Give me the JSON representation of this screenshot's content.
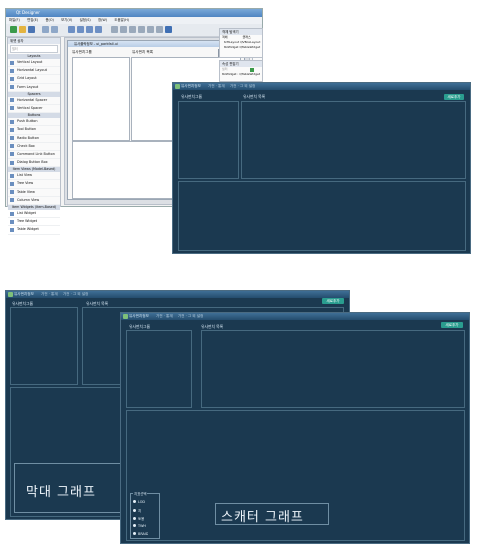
{
  "designer": {
    "title": "Qt Designer",
    "menu": [
      "파일(F)",
      "편집(E)",
      "폼(O)",
      "보기(V)",
      "설정(S)",
      "창(W)",
      "도움말(H)"
    ],
    "widget_box": {
      "title": "위젯 상자",
      "filter_placeholder": "필터",
      "categories": [
        "Layouts",
        "Spacers",
        "Buttons",
        "Item Views (Model-Based)"
      ],
      "items": [
        "Vertical Layout",
        "Horizontal Layout",
        "Grid Layout",
        "Form Layout",
        "Horizontal Spacer",
        "Vertical Spacer",
        "Push Button",
        "Tool Button",
        "Radio Button",
        "Check Box",
        "Command Link Button",
        "Dialog Button Box",
        "List View",
        "Tree View",
        "Table View",
        "Column View",
        "Item Widgets (Item-Based)",
        "List Widget",
        "Tree Widget",
        "Table Widget"
      ]
    },
    "form_window": {
      "title": "유사플락정보 - ui_parkfall.ui",
      "left_label": "유사펀치그룹",
      "right_label": "유사펀치 목록",
      "button": "새로추가"
    },
    "object_inspector": {
      "title": "객체 탐색기",
      "col_object": "객체",
      "col_class": "클래스",
      "rows": [
        [
          "tzHLayout",
          "QVBoxLayout"
        ],
        [
          "tblWidget",
          "QTableWidget"
        ]
      ]
    },
    "property_editor": {
      "title": "속성 편집기",
      "filter_placeholder": "필터",
      "object_label": "tblWidget : QTableWidget"
    }
  },
  "dark1": {
    "title": "유사펀치정보",
    "tabs": [
      "가전 · 통계",
      "가전 · 그 외 설정"
    ],
    "left_label": "유사펀치그룹",
    "right_label": "유사펀치 목록",
    "button": "새로추가"
  },
  "dark2": {
    "title": "유사펀치정보",
    "tabs": [
      "가전 · 통계",
      "가전 · 그 외 설정"
    ],
    "left_label": "유사펀치그룹",
    "right_label": "유사펀치 목록",
    "button": "새로추가",
    "chart_caption": "막대 그래프"
  },
  "dark3": {
    "title": "유사펀치정보",
    "tabs": [
      "가전 · 통계",
      "가전 · 그 외 설정"
    ],
    "left_label": "유사펀치그룹",
    "right_label": "유사펀치 목록",
    "button": "새로추가",
    "legend_title": "지표선택",
    "legend_items": [
      "LOD",
      "지",
      "토용",
      "TWH",
      "BRAID"
    ],
    "chart_caption": "스캐터 그래프"
  }
}
